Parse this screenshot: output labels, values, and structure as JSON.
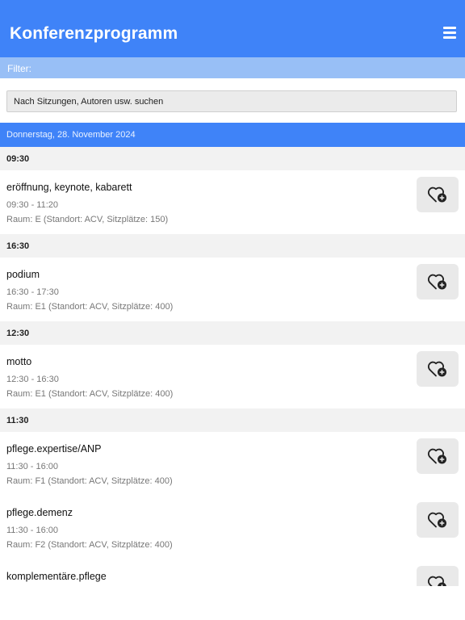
{
  "header": {
    "title": "Konferenzprogramm"
  },
  "filter": {
    "label": "Filter:",
    "placeholder": "Nach Sitzungen, Autoren usw. suchen"
  },
  "date": "Donnerstag, 28. November 2024",
  "groups": [
    {
      "time": "09:30",
      "sessions": [
        {
          "name": "eröffnung, keynote, kabarett",
          "time": "09:30 - 11:20",
          "room": "Raum: E (Standort: ACV, Sitzplätze: 150)"
        }
      ]
    },
    {
      "time": "16:30",
      "sessions": [
        {
          "name": "podium",
          "time": "16:30 - 17:30",
          "room": "Raum: E1 (Standort: ACV, Sitzplätze: 400)"
        }
      ]
    },
    {
      "time": "12:30",
      "sessions": [
        {
          "name": "motto",
          "time": "12:30 - 16:30",
          "room": "Raum: E1 (Standort: ACV, Sitzplätze: 400)"
        }
      ]
    },
    {
      "time": "11:30",
      "sessions": [
        {
          "name": "pflege.expertise/ANP",
          "time": "11:30 - 16:00",
          "room": "Raum: F1 (Standort: ACV, Sitzplätze: 400)"
        },
        {
          "name": "pflege.demenz",
          "time": "11:30 - 16:00",
          "room": "Raum: F2 (Standort: ACV, Sitzplätze: 400)"
        },
        {
          "name": "komplementäre.pflege"
        }
      ]
    }
  ],
  "icons": {
    "menu": "hamburger-menu-icon",
    "favorite": "heart-plus-icon"
  },
  "colors": {
    "primary": "#3f83f8",
    "filter_bar": "#98bff6",
    "time_header": "#f2f2f2",
    "button_bg": "#e9e9e9"
  }
}
